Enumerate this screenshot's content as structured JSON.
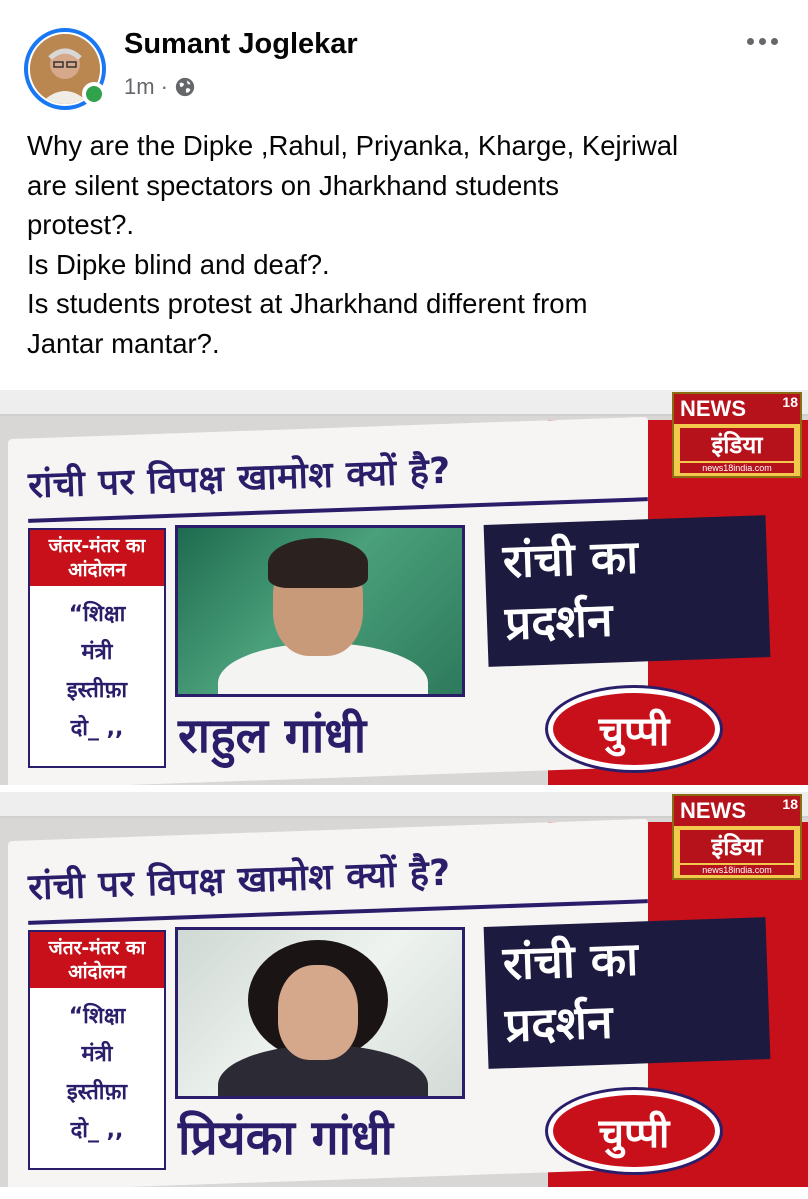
{
  "post": {
    "author": "Sumant Joglekar",
    "time": "1m",
    "separator": "·",
    "privacy_icon": "globe-icon",
    "more_icon": "more-options-icon",
    "text_lines": [
      "Why are the Dipke ,Rahul, Priyanka, Kharge, Kejriwal",
      "are silent spectators on Jharkhand students",
      "protest?.",
      "Is Dipke blind and deaf?.",
      "Is students protest at Jharkhand different from",
      "Jantar mantar?."
    ]
  },
  "frames": [
    {
      "headline": "रांची पर विपक्ष खामोश क्यों है?",
      "left_box_header": "जंतर-मंतर का आंदोलन",
      "left_box_lines": [
        "“शिक्षा",
        "मंत्री",
        "इस्तीफ़ा",
        "दो_ ,,"
      ],
      "name": "राहुल गांधी",
      "box_lines": [
        "रांची का",
        "प्रदर्शन"
      ],
      "badge": "चुप्पी",
      "logo_news": "NEWS",
      "logo_sup": "18",
      "logo_india": "इंडिया",
      "logo_url": "news18india.com"
    },
    {
      "headline": "रांची पर विपक्ष खामोश क्यों है?",
      "left_box_header": "जंतर-मंतर का आंदोलन",
      "left_box_lines": [
        "“शिक्षा",
        "मंत्री",
        "इस्तीफ़ा",
        "दो_ ,,"
      ],
      "name": "प्रियंका गांधी",
      "box_lines": [
        "रांची का",
        "प्रदर्शन"
      ],
      "badge": "चुप्पी",
      "logo_news": "NEWS",
      "logo_sup": "18",
      "logo_india": "इंडिया",
      "logo_url": "news18india.com"
    }
  ],
  "colors": {
    "link_blue": "#1877f2",
    "online_green": "#31a24c",
    "channel_red": "#c8101a",
    "channel_navy": "#2a1e6a"
  }
}
